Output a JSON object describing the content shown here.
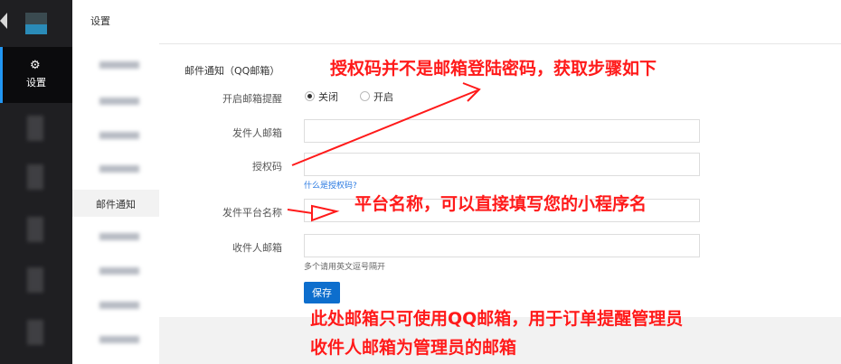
{
  "rail": {
    "active_item": {
      "icon": "gear-icon",
      "label": "设置"
    }
  },
  "header": {
    "breadcrumb": "设置"
  },
  "submenu": {
    "selected_label": "邮件通知"
  },
  "form": {
    "section_title": "邮件通知（QQ邮箱）",
    "toggle_label": "开启邮箱提醒",
    "toggle_options": [
      "关闭",
      "开启"
    ],
    "toggle_selected": "关闭",
    "sender_label": "发件人邮箱",
    "authcode_label": "授权码",
    "authcode_link": "什么是授权码?",
    "platform_label": "发件平台名称",
    "recipient_label": "收件人邮箱",
    "recipient_hint": "多个请用英文逗号隔开",
    "save_label": "保存"
  },
  "annotations": {
    "authcode_note": "授权码并不是邮箱登陆密码，获取步骤如下",
    "platform_note": "平台名称，可以直接填写您的小程序名",
    "email_note_line1": "此处邮箱只可使用QQ邮箱，用于订单提醒管理员",
    "email_note_line2": "收件人邮箱为管理员的邮箱",
    "color": "#ff1a1a"
  }
}
